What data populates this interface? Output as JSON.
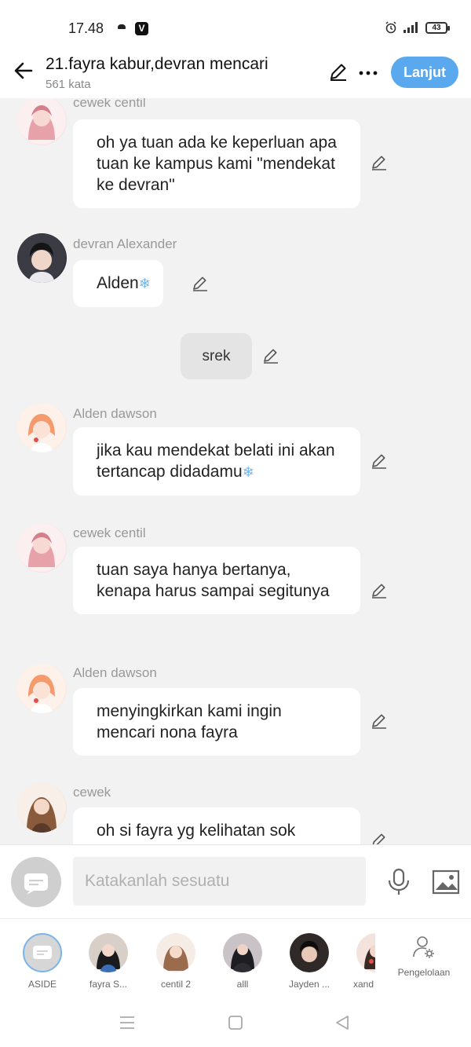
{
  "status": {
    "time": "17.48",
    "app_badge": "V",
    "battery": "43"
  },
  "header": {
    "title": "21.fayra kabur,devran mencari",
    "subtitle": "561 kata",
    "next_label": "Lanjut"
  },
  "messages": [
    {
      "sender": "cewek centil",
      "text": "oh ya tuan ada ke keperluan apa tuan ke kampus kami \"mendekat ke devran\""
    },
    {
      "sender": "devran Alexander",
      "text": "Alden"
    },
    {
      "narration": "srek"
    },
    {
      "sender": "Alden dawson",
      "text": "jika kau mendekat belati ini akan tertancap didadamu"
    },
    {
      "sender": "cewek centil",
      "text": "tuan saya hanya bertanya, kenapa harus sampai segitunya"
    },
    {
      "sender": "Alden dawson",
      "text": "menyingkirkan kami ingin mencari nona fayra"
    },
    {
      "sender": "cewek",
      "text": "oh si fayra yg kelihatan sok"
    }
  ],
  "composer": {
    "placeholder": "Katakanlah sesuatu"
  },
  "characters": [
    {
      "name": "ASIDE"
    },
    {
      "name": "fayra S..."
    },
    {
      "name": "centil 2"
    },
    {
      "name": "alll"
    },
    {
      "name": "Jayden ..."
    },
    {
      "name": "xand"
    }
  ],
  "manage_label": "Pengelolaan",
  "icons": [
    "back-arrow-icon",
    "pencil-icon",
    "more-icon",
    "snowflake-icon",
    "mic-icon",
    "image-icon",
    "manage-icon",
    "nav-menu-icon",
    "nav-home-icon",
    "nav-back-icon"
  ],
  "colors": {
    "accent": "#5aa9ef",
    "background": "#f2f2f2",
    "bubble": "#ffffff",
    "narration": "#e4e4e4"
  }
}
